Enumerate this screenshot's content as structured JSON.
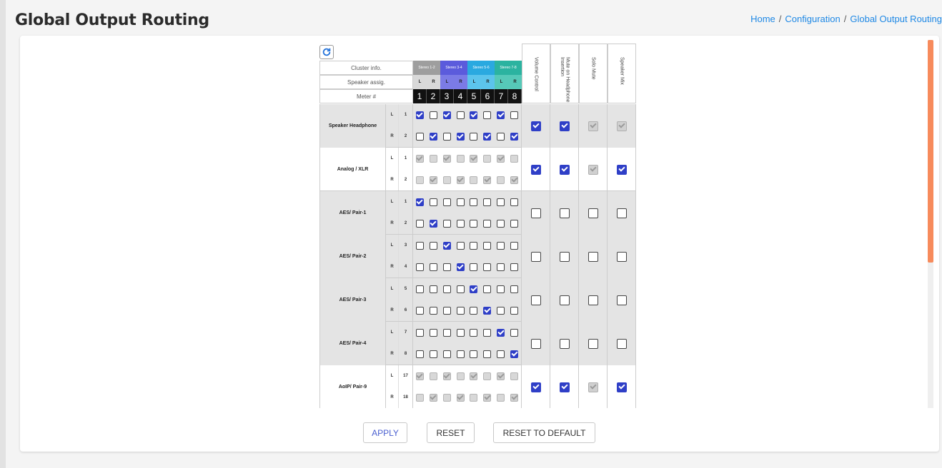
{
  "header": {
    "title": "Global Output Routing",
    "breadcrumb": [
      "Home",
      "Configuration",
      "Global Output Routing"
    ]
  },
  "routing": {
    "labels": {
      "cluster_info": "Cluster info.",
      "speaker_assig": "Speaker assig.",
      "meter": "Meter #"
    },
    "clusters": [
      {
        "label": "Stereo 1-2",
        "color": "#9e9e9e"
      },
      {
        "label": "Stereo 3-4",
        "color": "#5b5bdc"
      },
      {
        "label": "Stereo 5-6",
        "color": "#2aa9e0"
      },
      {
        "label": "Stereo 7-8",
        "color": "#2bb3a0"
      }
    ],
    "speaker_assign": [
      "L",
      "R",
      "L",
      "R",
      "L",
      "R",
      "L",
      "R"
    ],
    "assign_colors": [
      "#d9d9d9",
      "#d9d9d9",
      "#7b7be6",
      "#7b7be6",
      "#5cc4ec",
      "#5cc4ec",
      "#56c9b8",
      "#56c9b8"
    ],
    "meters": [
      "1",
      "2",
      "3",
      "4",
      "5",
      "6",
      "7",
      "8"
    ],
    "option_columns": [
      "Volume Control",
      "Mute on Headphone Insertion",
      "Solo Mute",
      "Speaker Mix"
    ],
    "groups": [
      {
        "name": "Speaker Headphone",
        "shaded": true,
        "rows": [
          {
            "lr": "L",
            "num": "1",
            "cells": [
              1,
              0,
              1,
              0,
              1,
              0,
              1,
              0
            ],
            "disabled": false
          },
          {
            "lr": "R",
            "num": "2",
            "cells": [
              0,
              1,
              0,
              1,
              0,
              1,
              0,
              1
            ],
            "disabled": false
          }
        ],
        "options": [
          {
            "c": 1,
            "d": 0
          },
          {
            "c": 1,
            "d": 0
          },
          {
            "c": 1,
            "d": 1
          },
          {
            "c": 1,
            "d": 1
          }
        ]
      },
      {
        "name": "Analog / XLR",
        "shaded": false,
        "rows": [
          {
            "lr": "L",
            "num": "1",
            "cells": [
              1,
              0,
              1,
              0,
              1,
              0,
              1,
              0
            ],
            "disabled": true
          },
          {
            "lr": "R",
            "num": "2",
            "cells": [
              0,
              1,
              0,
              1,
              0,
              1,
              0,
              1
            ],
            "disabled": true
          }
        ],
        "options": [
          {
            "c": 1,
            "d": 0
          },
          {
            "c": 1,
            "d": 0
          },
          {
            "c": 1,
            "d": 1
          },
          {
            "c": 1,
            "d": 0
          }
        ]
      },
      {
        "name": "AES/ Pair-1",
        "shaded": true,
        "rows": [
          {
            "lr": "L",
            "num": "1",
            "cells": [
              1,
              0,
              0,
              0,
              0,
              0,
              0,
              0
            ],
            "disabled": false
          },
          {
            "lr": "R",
            "num": "2",
            "cells": [
              0,
              1,
              0,
              0,
              0,
              0,
              0,
              0
            ],
            "disabled": false
          }
        ],
        "options": [
          {
            "c": 0,
            "d": 0
          },
          {
            "c": 0,
            "d": 0
          },
          {
            "c": 0,
            "d": 0
          },
          {
            "c": 0,
            "d": 0
          }
        ]
      },
      {
        "name": "AES/ Pair-2",
        "shaded": true,
        "rows": [
          {
            "lr": "L",
            "num": "3",
            "cells": [
              0,
              0,
              1,
              0,
              0,
              0,
              0,
              0
            ],
            "disabled": false
          },
          {
            "lr": "R",
            "num": "4",
            "cells": [
              0,
              0,
              0,
              1,
              0,
              0,
              0,
              0
            ],
            "disabled": false
          }
        ],
        "options": [
          {
            "c": 0,
            "d": 0
          },
          {
            "c": 0,
            "d": 0
          },
          {
            "c": 0,
            "d": 0
          },
          {
            "c": 0,
            "d": 0
          }
        ]
      },
      {
        "name": "AES/ Pair-3",
        "shaded": true,
        "rows": [
          {
            "lr": "L",
            "num": "5",
            "cells": [
              0,
              0,
              0,
              0,
              1,
              0,
              0,
              0
            ],
            "disabled": false
          },
          {
            "lr": "R",
            "num": "6",
            "cells": [
              0,
              0,
              0,
              0,
              0,
              1,
              0,
              0
            ],
            "disabled": false
          }
        ],
        "options": [
          {
            "c": 0,
            "d": 0
          },
          {
            "c": 0,
            "d": 0
          },
          {
            "c": 0,
            "d": 0
          },
          {
            "c": 0,
            "d": 0
          }
        ]
      },
      {
        "name": "AES/ Pair-4",
        "shaded": true,
        "rows": [
          {
            "lr": "L",
            "num": "7",
            "cells": [
              0,
              0,
              0,
              0,
              0,
              0,
              1,
              0
            ],
            "disabled": false
          },
          {
            "lr": "R",
            "num": "8",
            "cells": [
              0,
              0,
              0,
              0,
              0,
              0,
              0,
              1
            ],
            "disabled": false
          }
        ],
        "options": [
          {
            "c": 0,
            "d": 0
          },
          {
            "c": 0,
            "d": 0
          },
          {
            "c": 0,
            "d": 0
          },
          {
            "c": 0,
            "d": 0
          }
        ]
      },
      {
        "name": "AoIP/ Pair-9",
        "shaded": false,
        "rows": [
          {
            "lr": "L",
            "num": "17",
            "cells": [
              1,
              0,
              1,
              0,
              1,
              0,
              1,
              0
            ],
            "disabled": true
          },
          {
            "lr": "R",
            "num": "18",
            "cells": [
              0,
              1,
              0,
              1,
              0,
              1,
              0,
              1
            ],
            "disabled": true
          }
        ],
        "options": [
          {
            "c": 1,
            "d": 0
          },
          {
            "c": 1,
            "d": 0
          },
          {
            "c": 1,
            "d": 1
          },
          {
            "c": 1,
            "d": 0
          }
        ]
      }
    ]
  },
  "actions": {
    "apply": "APPLY",
    "reset": "RESET",
    "reset_default": "RESET TO DEFAULT"
  },
  "colors": {
    "accent": "#2f3fc7",
    "breadcrumb": "#1e88e5",
    "scrollbar": "#f78b5c"
  }
}
